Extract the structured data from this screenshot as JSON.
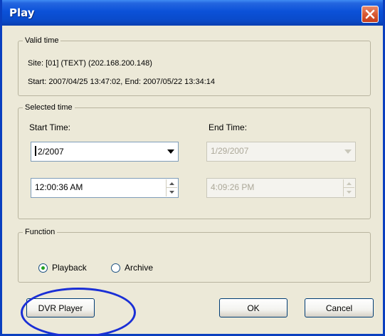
{
  "window": {
    "title": "Play"
  },
  "valid_time": {
    "legend": "Valid time",
    "site_line": "Site: [01]       (TEXT) (202.168.200.148)",
    "range_line": "Start: 2007/04/25 13:47:02,  End: 2007/05/22 13:34:14"
  },
  "selected_time": {
    "legend": "Selected time",
    "start_label": "Start Time:",
    "end_label": "End Time:",
    "start_date": "2/2007",
    "start_time": "12:00:36 AM",
    "end_date": "1/29/2007",
    "end_time": "4:09:26 PM"
  },
  "function": {
    "legend": "Function",
    "options": [
      "Playback",
      "Archive"
    ],
    "selected": "Playback"
  },
  "buttons": {
    "dvr_player": "DVR Player",
    "ok": "OK",
    "cancel": "Cancel"
  },
  "colors": {
    "title_bar": "#0a4ac9",
    "dialog_bg": "#ece9d8",
    "close_button": "#d85a33",
    "annotation_ellipse": "#1a2fd6"
  }
}
